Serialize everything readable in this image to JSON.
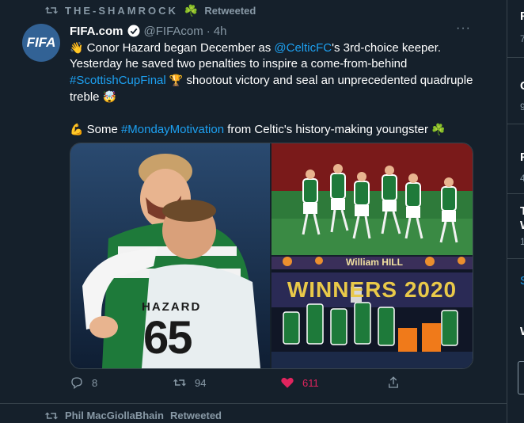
{
  "retweet_header": {
    "name": "THE-SHAMROCK",
    "suffix": "Retweeted",
    "clover": "☘️"
  },
  "tweet": {
    "avatar_text": "FIFA",
    "display_name": "FIFA.com",
    "handle": "@FIFAcom",
    "separator": "·",
    "time": "4h",
    "more": "···",
    "line1_a": "Conor Hazard began December as ",
    "mention": "@CelticFC",
    "line1_b": "'s 3rd-choice keeper. Yesterday he saved two penalties to inspire a come-from-behind ",
    "hashtag1": "#ScottishCupFinal",
    "line1_c": " shootout victory and seal an unprecedented quadruple treble",
    "line2_a": " Some ",
    "hashtag2": "#MondayMotivation",
    "line2_b": " from Celtic's history-making youngster ",
    "emoji_wave": "👋",
    "emoji_trophy": "🏆",
    "emoji_mindblown": "🤯",
    "emoji_muscle": "💪",
    "emoji_clover": "☘️"
  },
  "media": {
    "shirt_name": "HAZARD",
    "shirt_number": "65",
    "banner_text": "WINNERS 2020",
    "sponsor_text": "William HILL"
  },
  "actions": {
    "replies": "8",
    "retweets": "94",
    "likes": "611"
  },
  "next_retweet": {
    "name": "Phil MacGiollaBhain",
    "suffix": "Retweeted"
  },
  "sidebar_fragments": {
    "f1": "7",
    "f2": "F",
    "f3": "C",
    "f4": "9",
    "f5": "R",
    "f6": "4",
    "f7": "T",
    "f8": "W",
    "f9": "1",
    "f10": "S",
    "f11": "W"
  },
  "colors": {
    "background": "#15202b",
    "link": "#1da1f2",
    "muted": "#8899a6",
    "like": "#e0245e"
  }
}
